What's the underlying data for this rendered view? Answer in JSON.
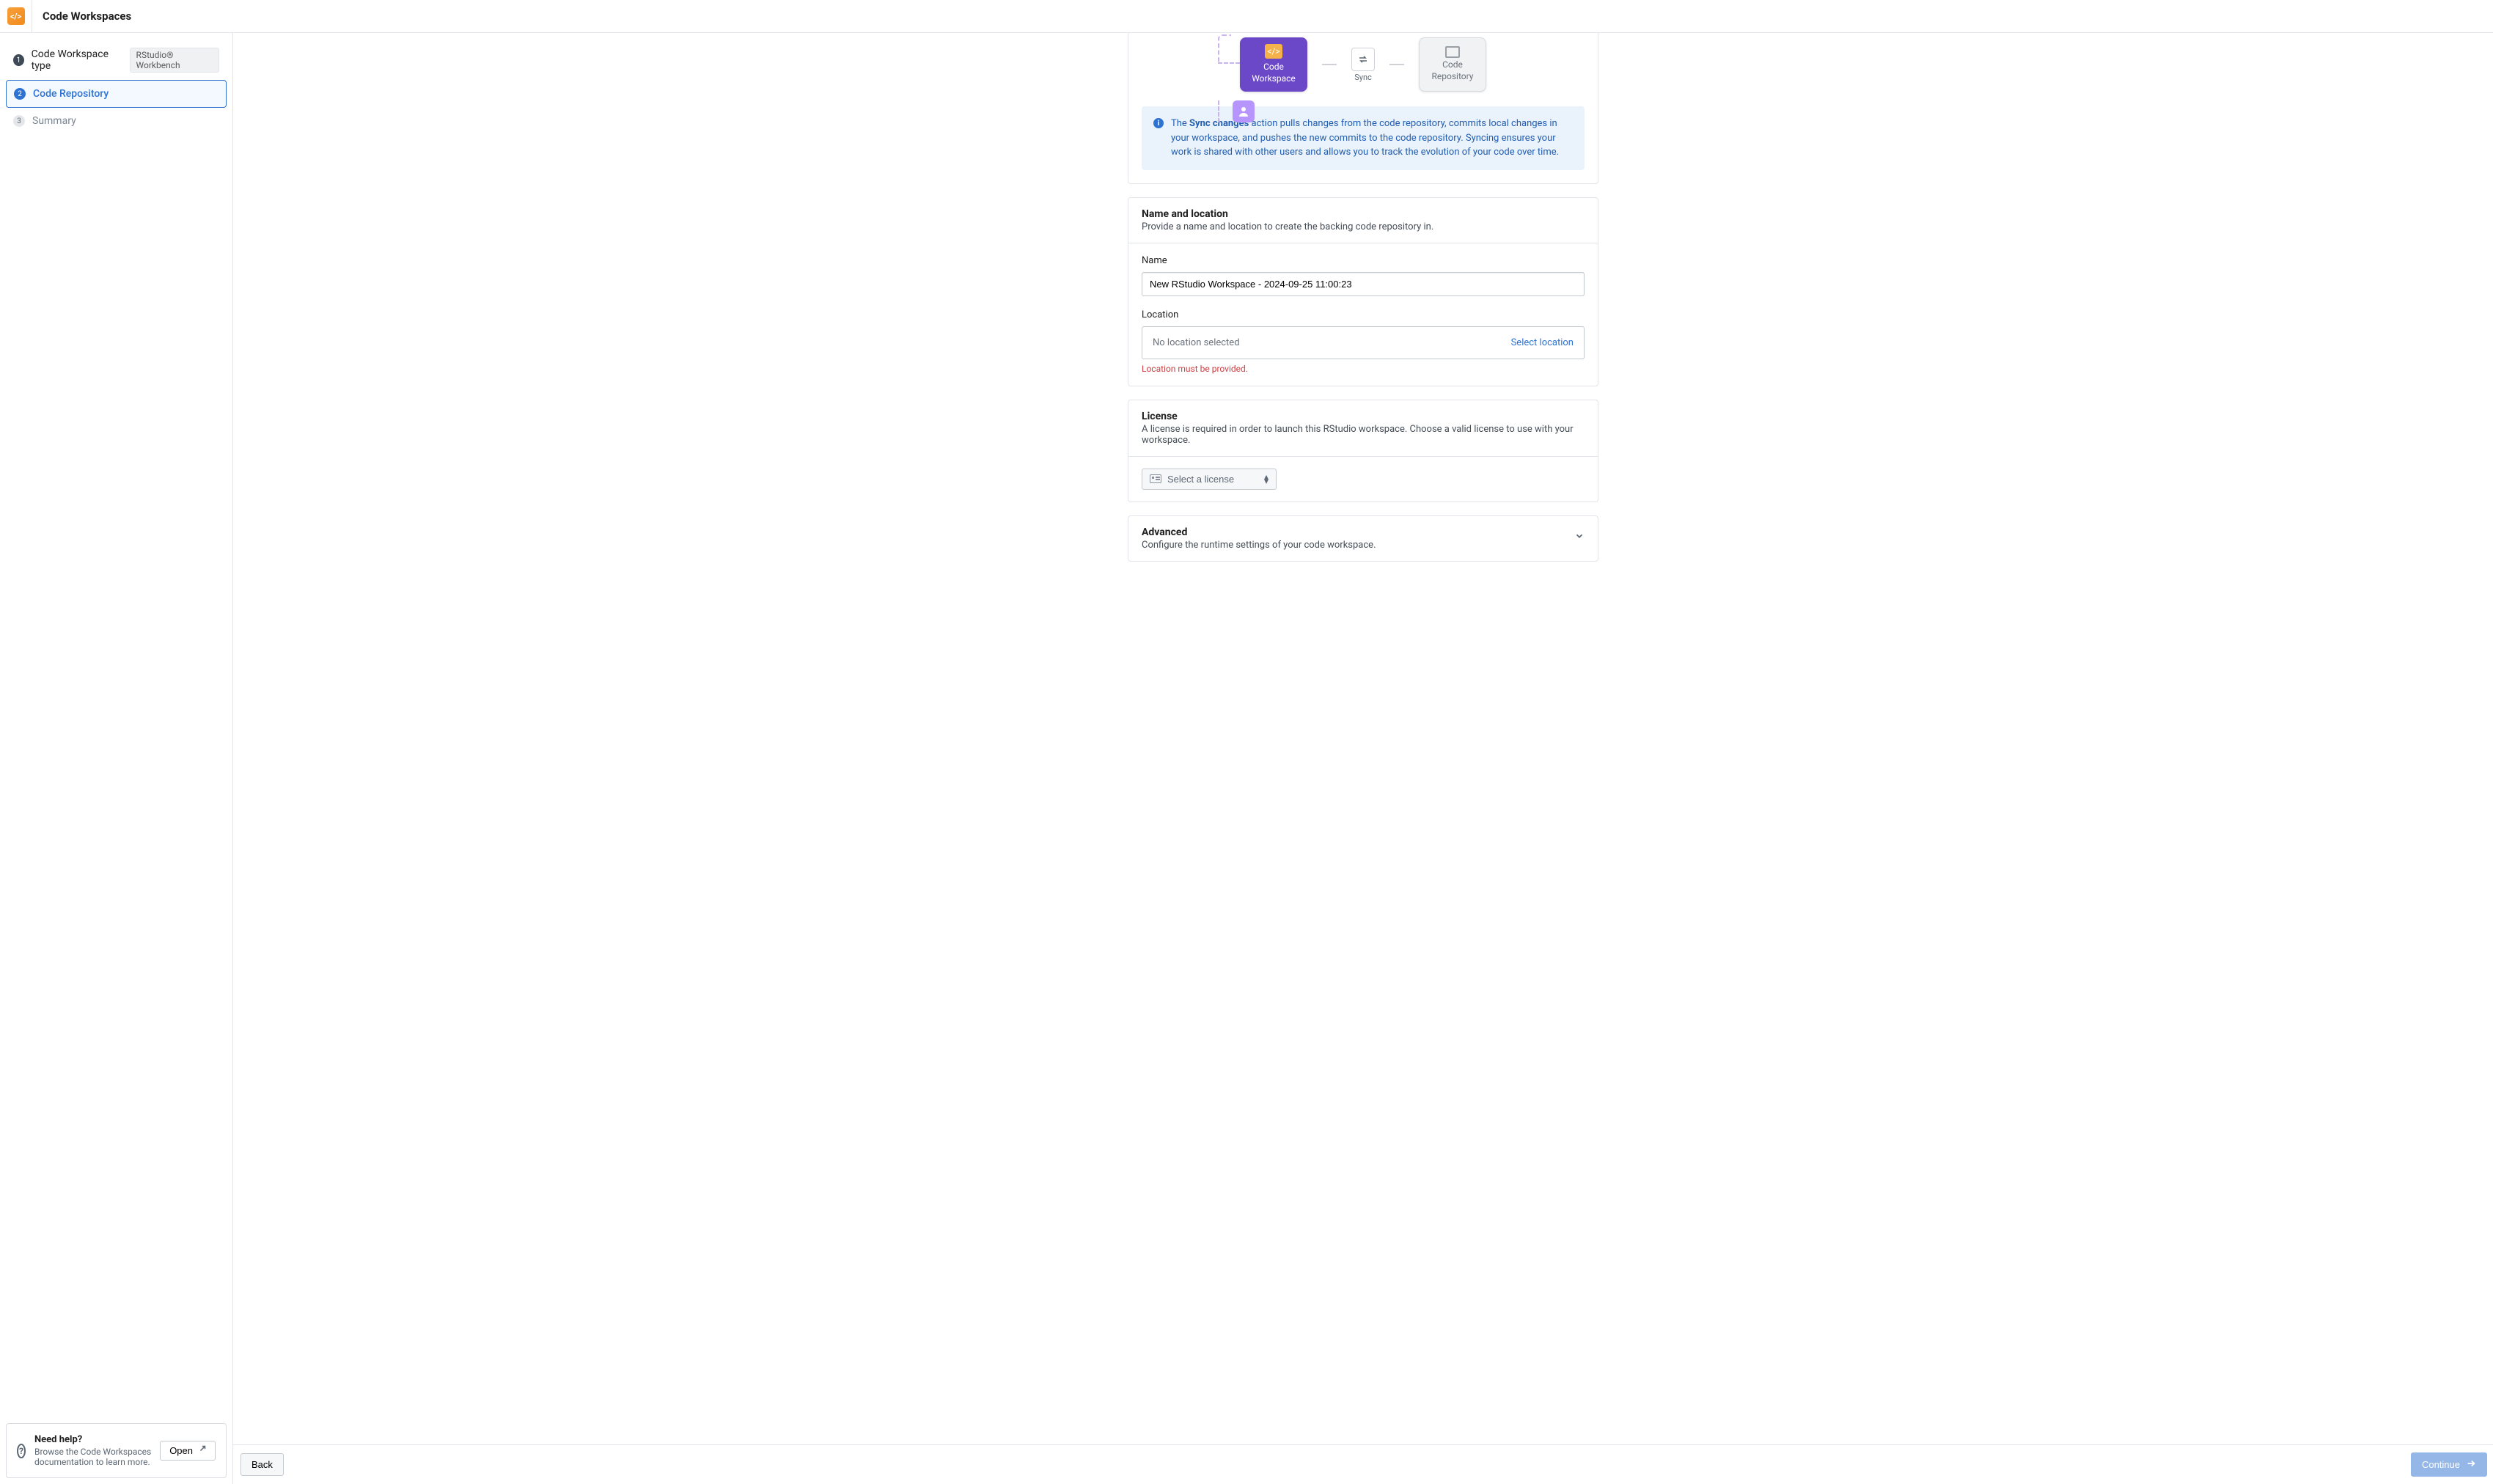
{
  "header": {
    "title": "Code Workspaces"
  },
  "sidebar": {
    "steps": [
      {
        "num": "1",
        "label": "Code Workspace type",
        "pill": "RStudio® Workbench"
      },
      {
        "num": "2",
        "label": "Code Repository"
      },
      {
        "num": "3",
        "label": "Summary"
      }
    ],
    "help": {
      "title": "Need help?",
      "desc": "Browse the Code Workspaces documentation to learn more.",
      "open": "Open"
    }
  },
  "diagram": {
    "workspace": "Code\nWorkspace",
    "repo": "Code\nRepository",
    "sync": "Sync"
  },
  "infoCallout": {
    "prefix": "The ",
    "strong": "Sync changes",
    "rest": " action pulls changes from the code repository, commits local changes in your workspace, and pushes the new commits to the code repository. Syncing ensures your work is shared with other users and allows you to track the evolution of your code over time."
  },
  "nameSection": {
    "title": "Name and location",
    "desc": "Provide a name and location to create the backing code repository in.",
    "nameLabel": "Name",
    "nameValue": "New RStudio Workspace - 2024-09-25 11:00:23",
    "locationLabel": "Location",
    "locationEmpty": "No location selected",
    "selectLocation": "Select location",
    "locationError": "Location must be provided."
  },
  "licenseSection": {
    "title": "License",
    "desc": "A license is required in order to launch this RStudio workspace. Choose a valid license to use with your workspace.",
    "selectLabel": "Select a license"
  },
  "advancedSection": {
    "title": "Advanced",
    "desc": "Configure the runtime settings of your code workspace."
  },
  "footer": {
    "back": "Back",
    "continue": "Continue"
  }
}
